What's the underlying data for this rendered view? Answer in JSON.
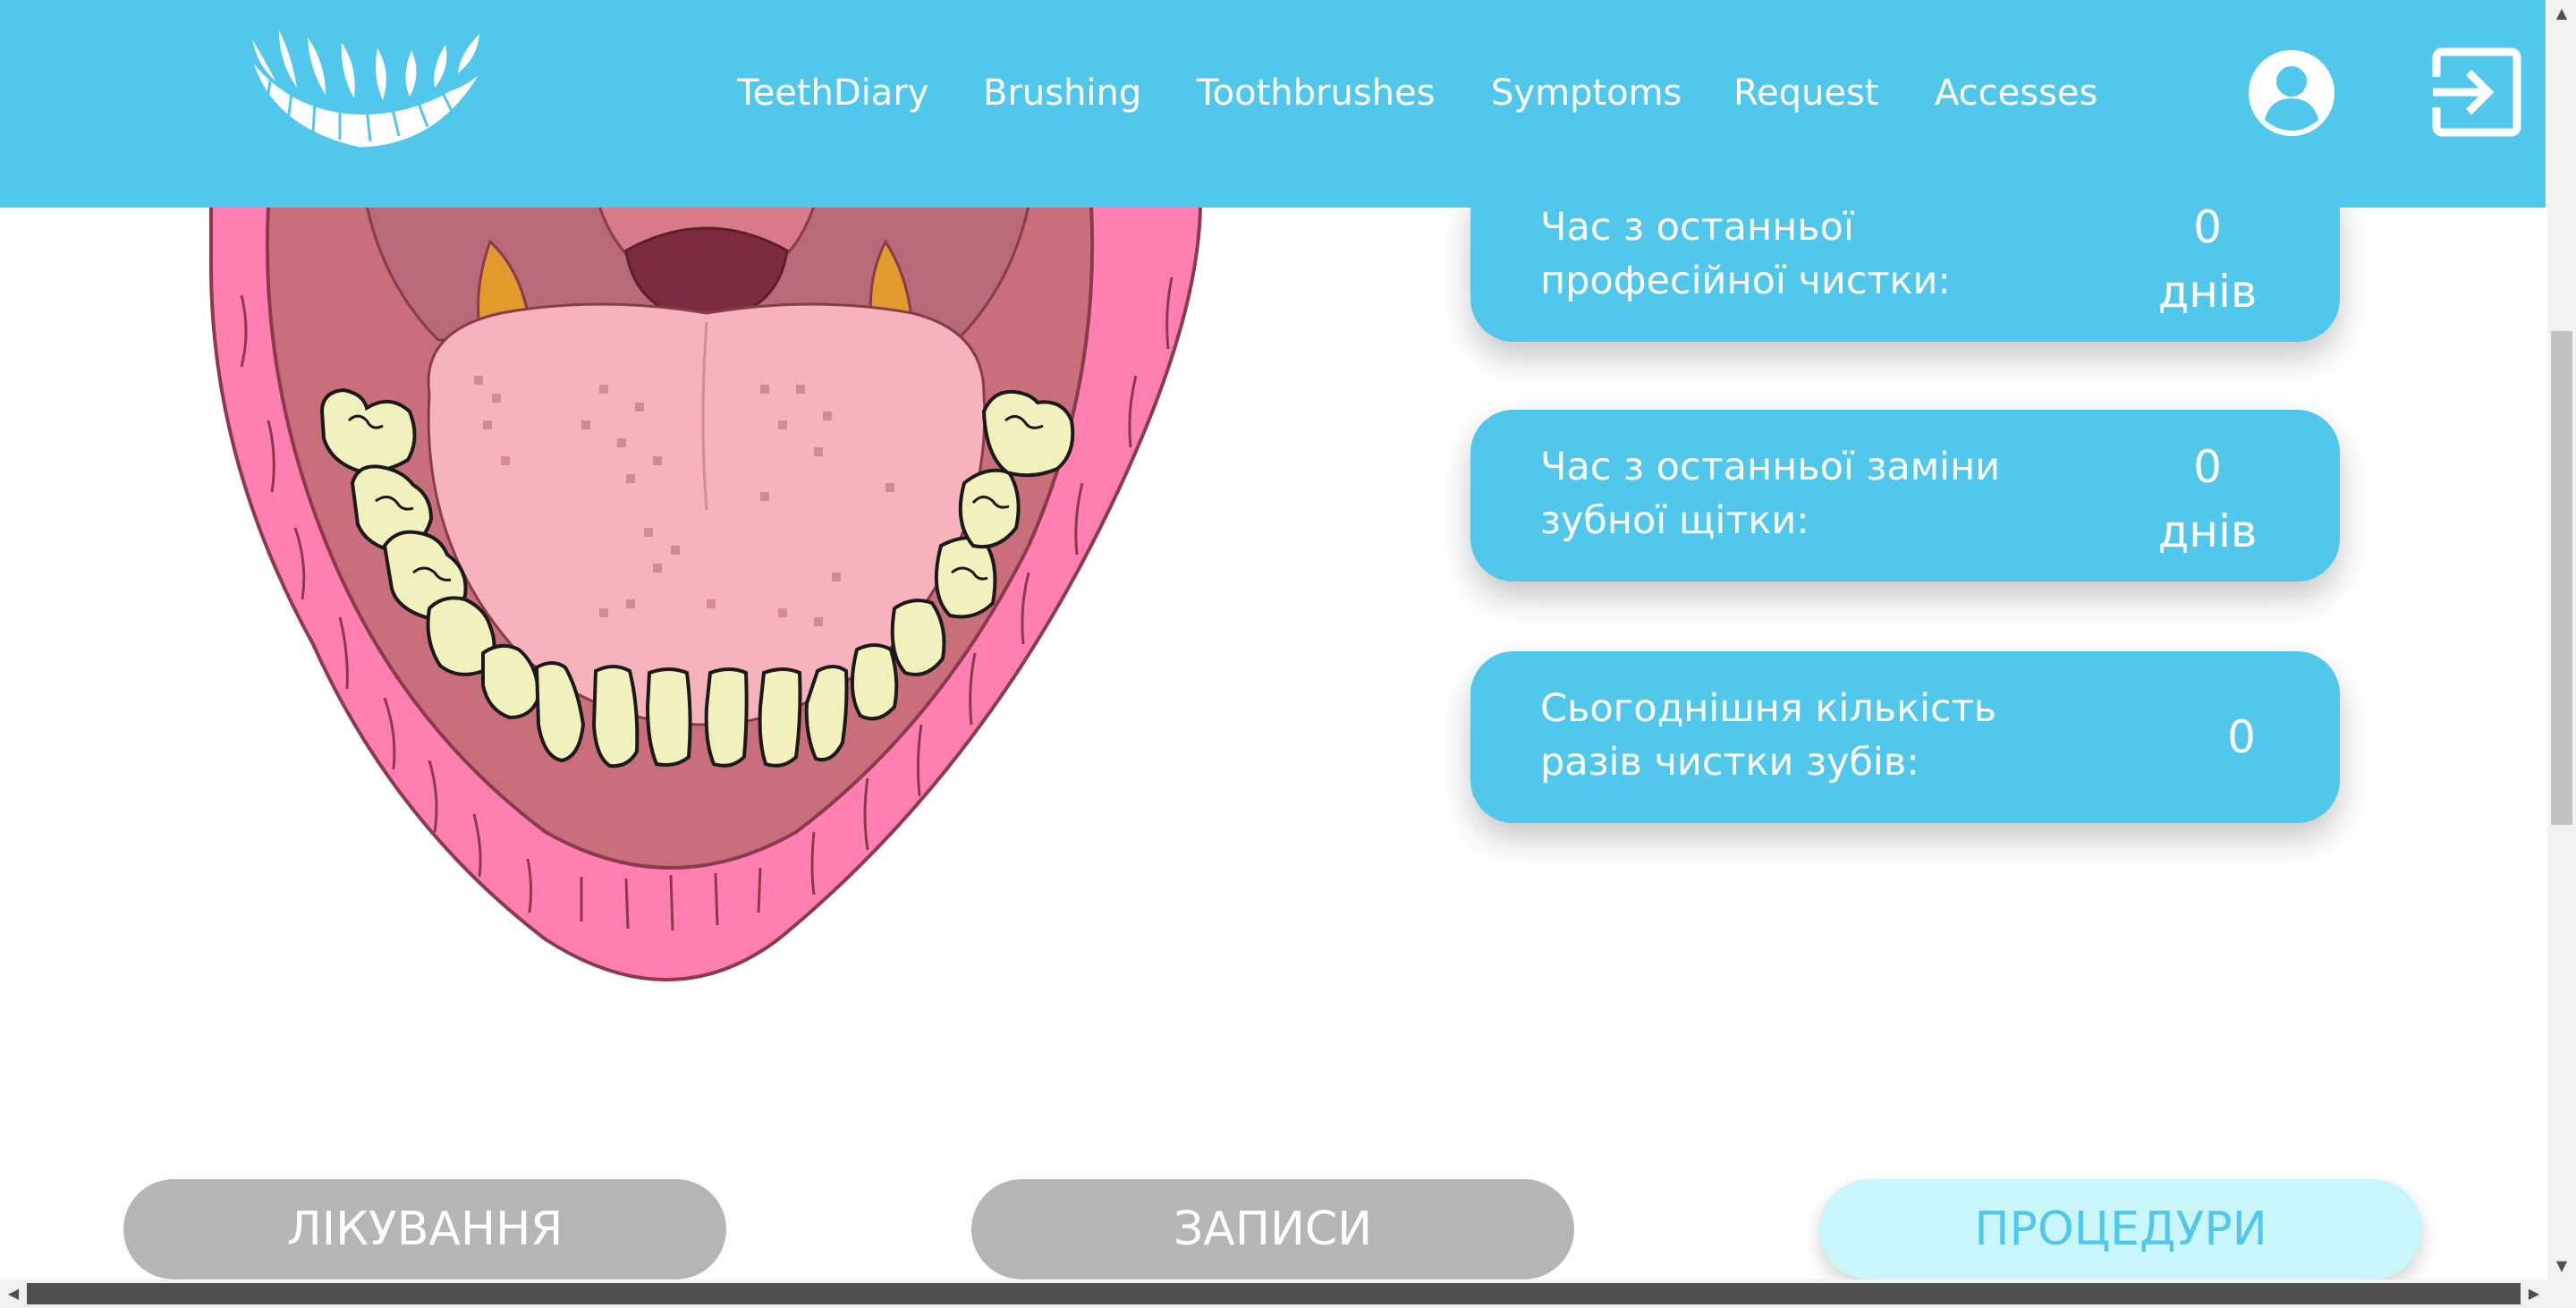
{
  "colors": {
    "brand": "#52c7ec",
    "button_inactive": "#b4b6b6",
    "button_active_bg": "#c8f6fb",
    "button_active_text": "#52c7ec"
  },
  "header": {
    "logo_icon": "teeth-smile-logo",
    "nav": [
      {
        "label": "TeethDiary"
      },
      {
        "label": "Brushing"
      },
      {
        "label": "Toothbrushes"
      },
      {
        "label": "Symptoms"
      },
      {
        "label": "Request"
      },
      {
        "label": "Accesses"
      }
    ],
    "user_icon": "user-account-icon",
    "logout_icon": "logout-icon"
  },
  "stats": [
    {
      "label": "Час з останньої професійної чистки:",
      "value": "0",
      "unit": "днів"
    },
    {
      "label": "Час з останньої заміни зубної щітки:",
      "value": "0",
      "unit": "днів"
    },
    {
      "label": "Сьогоднішня кількість разів чистки зубів:",
      "value": "0"
    }
  ],
  "buttons": [
    {
      "label": "ЛІКУВАННЯ",
      "active": false
    },
    {
      "label": "ЗАПИСИ",
      "active": false
    },
    {
      "label": "ПРОЦЕДУРИ",
      "active": true
    }
  ]
}
